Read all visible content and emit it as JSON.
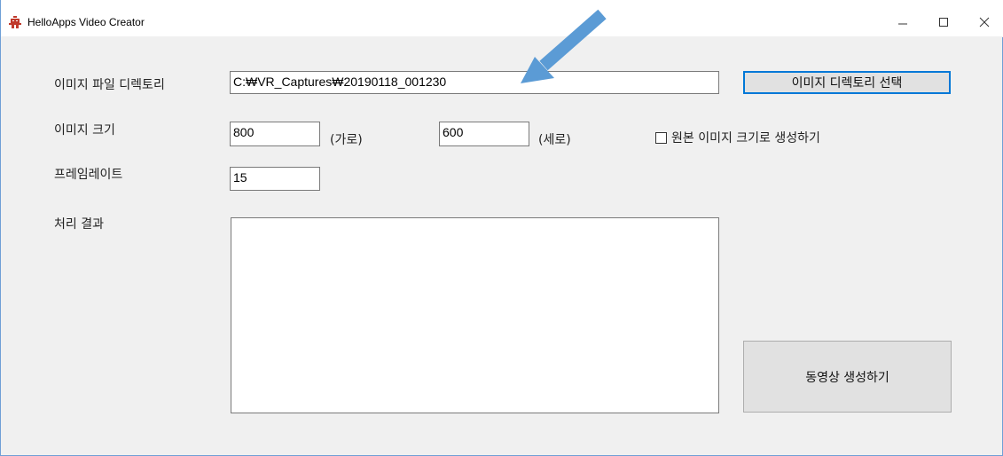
{
  "window": {
    "title": "HelloApps Video Creator"
  },
  "form": {
    "image_dir_label": "이미지 파일 디렉토리",
    "image_dir_value": "C:₩VR_Captures₩20190118_001230",
    "select_dir_button": "이미지 디렉토리 선택",
    "image_size_label": "이미지 크기",
    "width_value": "800",
    "width_unit": "(가로)",
    "height_value": "600",
    "height_unit": "(세로)",
    "original_size_checkbox": "원본 이미지 크기로 생성하기",
    "framerate_label": "프레임레이트",
    "framerate_value": "15",
    "result_label": "처리 결과",
    "result_text": "",
    "create_video_button": "동영상 생성하기"
  },
  "icons": {
    "app": "robot-icon",
    "minimize": "minimize-icon",
    "maximize": "maximize-icon",
    "close": "close-icon",
    "annotation": "arrow-icon"
  },
  "colors": {
    "window_border": "#6f9fd6",
    "window_bg": "#f0f0f0",
    "arrow": "#5b9bd5",
    "default_button_border": "#0078d7",
    "app_icon": "#c0392b"
  }
}
